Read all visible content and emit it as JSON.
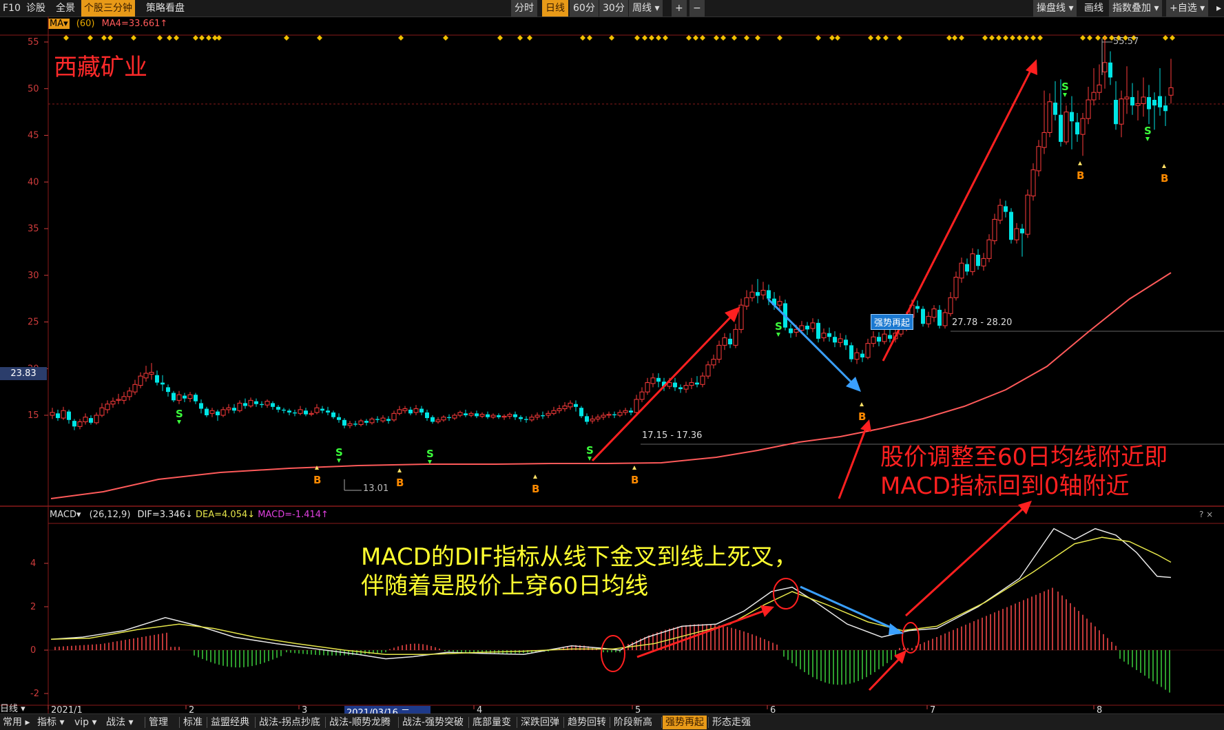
{
  "topbar": {
    "left_items": [
      "F10",
      "诊股",
      "全景",
      "个股三分钟",
      "策略看盘"
    ],
    "active_left": "个股三分钟",
    "period_tabs": [
      "分时",
      "日线",
      "60分",
      "30分",
      "周线 ▾"
    ],
    "active_period": "日线",
    "zoom_in": "+",
    "zoom_out": "−",
    "right_items": [
      "操盘线 ▾",
      "画线",
      "指数叠加 ▾",
      "+自选 ▾"
    ],
    "arrow": "▸"
  },
  "ma_indicator": {
    "selector": "MA▾",
    "param": "(60)",
    "value": "MA4=33.661↑"
  },
  "stock_name": "西藏矿业",
  "price_axis": {
    "ticks": [
      "55",
      "50",
      "45",
      "40",
      "35",
      "30",
      "25",
      "20",
      "15"
    ],
    "current_price": "23.83"
  },
  "price_labels": {
    "high": "55.57",
    "low": "13.01",
    "range_1": "17.15 - 17.36",
    "range_2": "27.78 - 28.20",
    "strong_tag": "强势再起"
  },
  "signals": {
    "sell": "S",
    "buy": "B"
  },
  "annotations": {
    "right_note_line1": "股价调整至60日均线附近即",
    "right_note_line2": "MACD指标回到0轴附近",
    "macd_note_line1": "MACD的DIF指标从线下金叉到线上死叉，",
    "macd_note_line2": "伴随着是股价上穿60日均线"
  },
  "macd_indicator": {
    "selector": "MACD▾",
    "params": "(26,12,9)",
    "dif": "DIF=3.346↓",
    "dea": "DEA=4.054↓",
    "macd": "MACD=-1.414↑",
    "ticks": [
      "4",
      "2",
      "0",
      "-2"
    ],
    "corner": "? ×"
  },
  "time_axis": {
    "labels": [
      "2021/1",
      "2",
      "3",
      "4",
      "5",
      "6",
      "7",
      "8"
    ],
    "cursor_date": "2021/03/16,二"
  },
  "bottombar": {
    "items": [
      "日线 ▾",
      "常用 ▸",
      "指标 ▾",
      "vip ▾",
      "战法 ▾",
      "管理",
      "标准",
      "益盟经典",
      "战法-拐点抄底",
      "战法-顺势龙腾",
      "战法-强势突破",
      "底部量变",
      "深跌回弹",
      "趋势回转",
      "阶段新高",
      "强势再起",
      "形态走强"
    ],
    "active": "强势再起"
  },
  "colors": {
    "up": "#ff3c3c",
    "down": "#00e5e5",
    "ma60": "#ff5a5a",
    "dif": "#e8e8e8",
    "dea": "#e6e64a",
    "arrow_red": "#ff2020",
    "arrow_blue": "#3aa0ff",
    "annotation_yellow": "#ffff30"
  }
}
